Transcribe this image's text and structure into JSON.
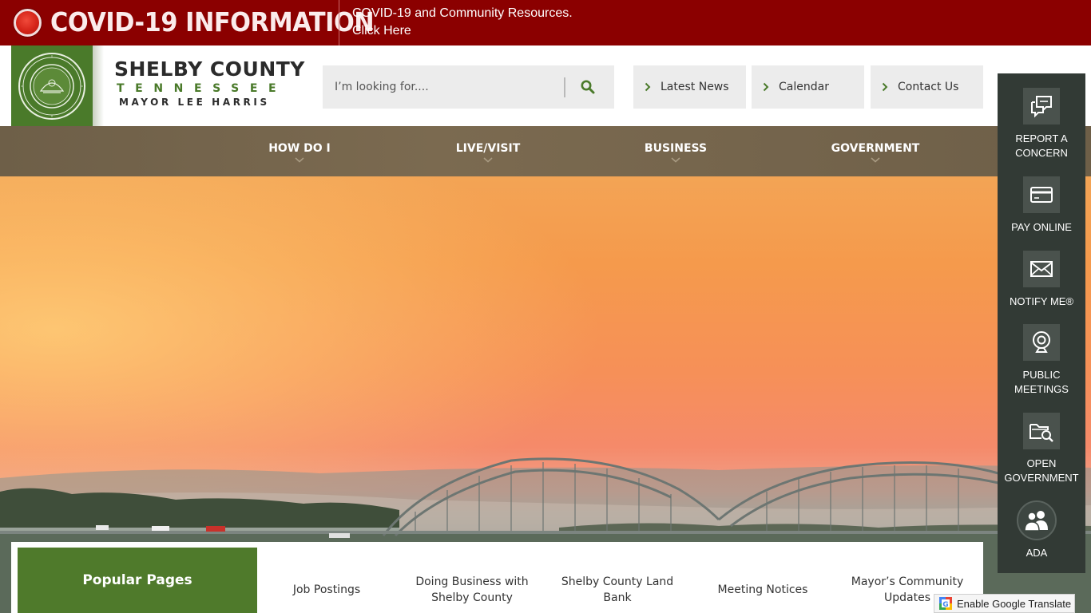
{
  "alert": {
    "title": "COVID-19 INFORMATION",
    "link_line1": "COVID-19 and Community Resources.",
    "link_line2": "Click Here"
  },
  "logo": {
    "line1": "SHELBY COUNTY",
    "line2": "TENNESSEE",
    "line3": "MAYOR LEE HARRIS"
  },
  "search": {
    "placeholder": "I’m looking for...."
  },
  "quick_links": [
    {
      "label": "Latest News"
    },
    {
      "label": "Calendar"
    },
    {
      "label": "Contact Us"
    }
  ],
  "nav": [
    {
      "label": "HOW DO I"
    },
    {
      "label": "LIVE/VISIT"
    },
    {
      "label": "BUSINESS"
    },
    {
      "label": "GOVERNMENT"
    }
  ],
  "side_panel": [
    {
      "line1": "REPORT A",
      "line2": "CONCERN",
      "icon": "chat-bubbles-icon"
    },
    {
      "line1": "PAY ONLINE",
      "line2": "",
      "icon": "credit-card-icon"
    },
    {
      "line1": "NOTIFY ME®",
      "line2": "",
      "icon": "envelope-icon"
    },
    {
      "line1": "PUBLIC",
      "line2": "MEETINGS",
      "icon": "webcam-icon"
    },
    {
      "line1": "OPEN",
      "line2": "GOVERNMENT",
      "icon": "folder-search-icon"
    },
    {
      "line1": "ADA",
      "line2": "",
      "icon": "people-icon"
    }
  ],
  "popular": {
    "title": "Popular Pages",
    "links": [
      {
        "line1": "Job Postings",
        "line2": ""
      },
      {
        "line1": "Doing Business with",
        "line2": "Shelby County"
      },
      {
        "line1": "Shelby County Land",
        "line2": "Bank"
      },
      {
        "line1": "Meeting Notices",
        "line2": ""
      },
      {
        "line1": "Mayor’s Community",
        "line2": "Updates"
      }
    ]
  },
  "translate": {
    "label": "Enable Google Translate"
  },
  "colors": {
    "alert_bg": "#8b0000",
    "brand_green": "#4f7a2b",
    "nav_bg": "#756550",
    "side_panel_bg": "#323a35"
  }
}
